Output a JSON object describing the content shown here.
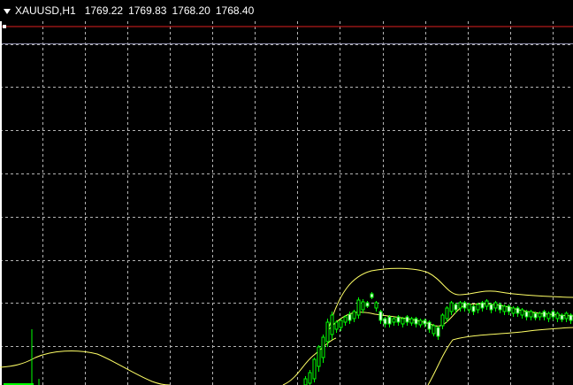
{
  "header": {
    "symbol_timeframe": "XAUUSD,H1",
    "open": "1769.22",
    "high": "1769.83",
    "low": "1768.20",
    "close": "1768.40"
  },
  "colors": {
    "background": "#000000",
    "grid": "#b4b4b4",
    "bid_line": "#e02020",
    "ask_line": "#8c8ca8",
    "bull_candle": "#00ff00",
    "bear_candle_fill": "#ffffff",
    "bollinger_bands": "#ffff66",
    "volume_spike": "#00ff00"
  },
  "chart_data": {
    "type": "candlestick",
    "indicator": "Bollinger Bands",
    "grid": true
  }
}
